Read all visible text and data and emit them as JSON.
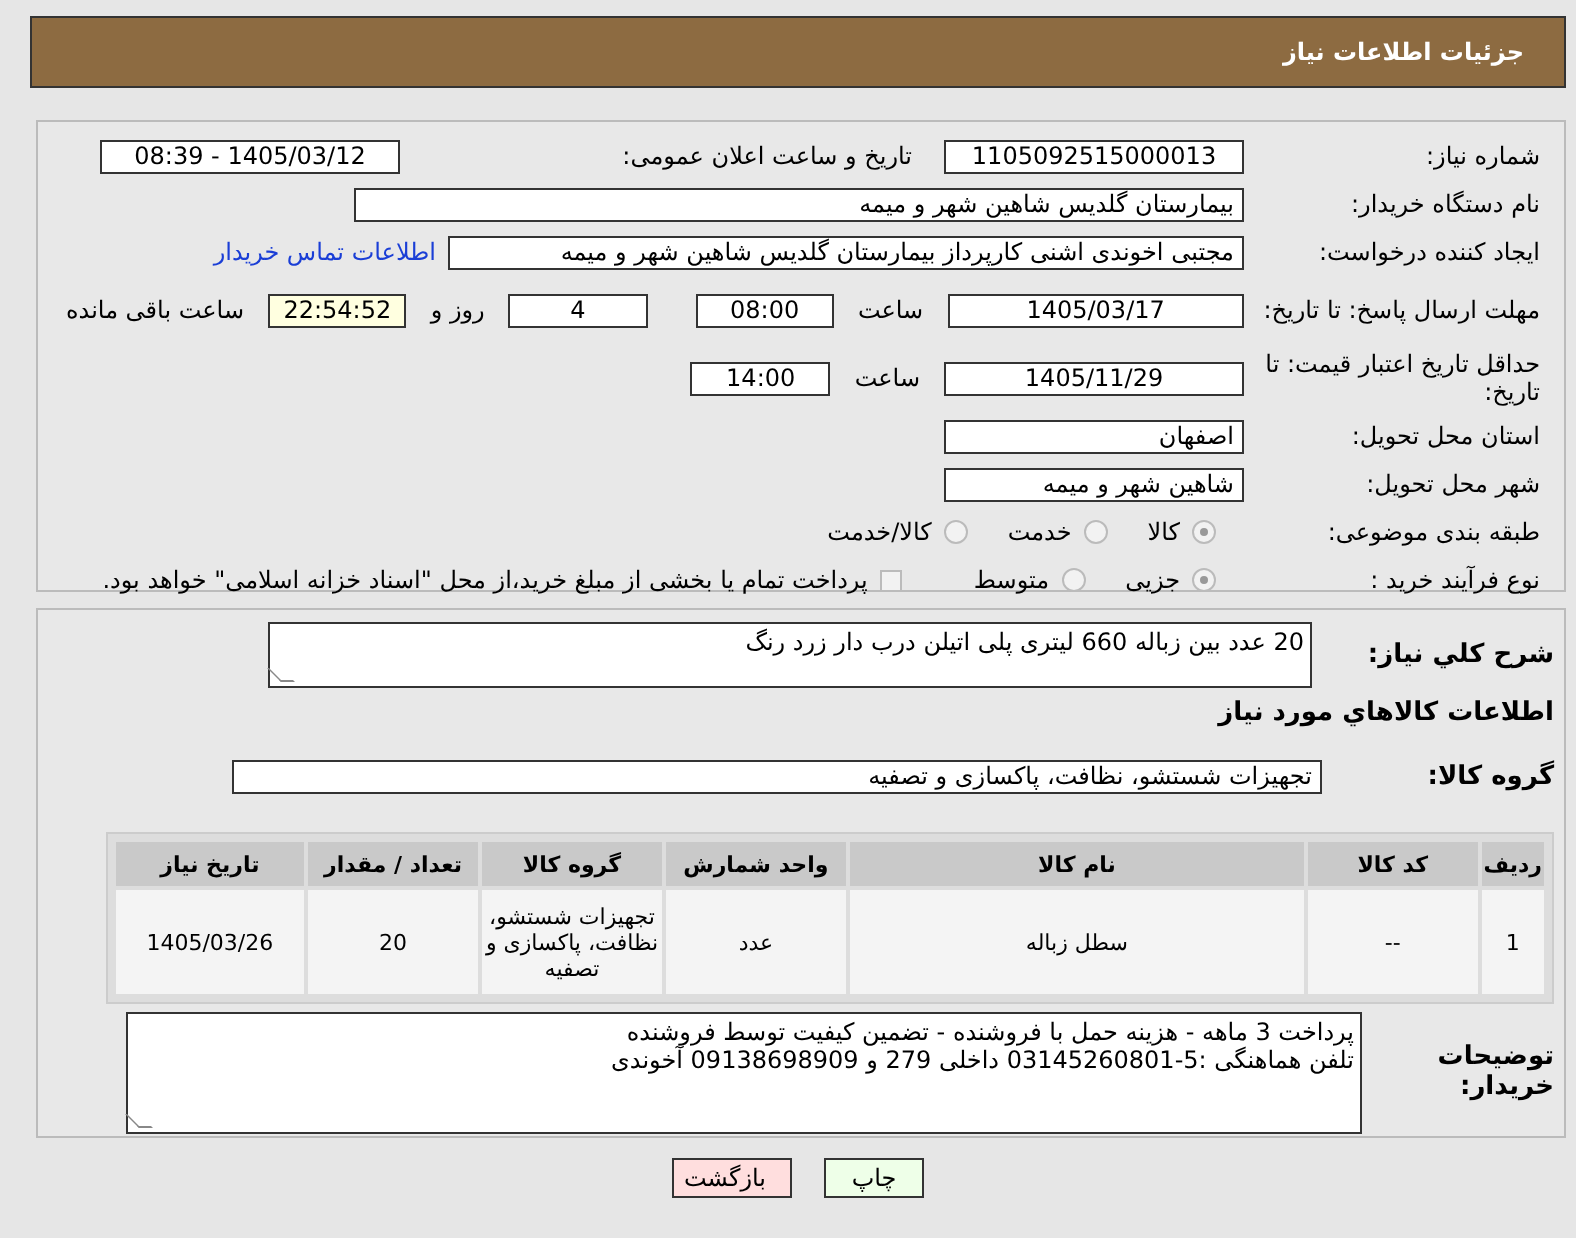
{
  "header": {
    "title": "جزئیات اطلاعات نیاز"
  },
  "need_number": {
    "label": "شماره نیاز:",
    "value": "1105092515000013"
  },
  "announce": {
    "label": "تاریخ و ساعت اعلان عمومی:",
    "value": "1405/03/12 - 08:39"
  },
  "buyer": {
    "label": "نام دستگاه خریدار:",
    "value": "بیمارستان گلدیس  شاهین شهر و میمه"
  },
  "creator": {
    "label": "ایجاد کننده درخواست:",
    "value": "مجتبی اخوندی اشنی کارپرداز بیمارستان گلدیس  شاهین شهر و میمه",
    "link": "اطلاعات تماس خریدار"
  },
  "reply_deadline": {
    "label": "مهلت ارسال پاسخ: تا تاریخ:",
    "date": "1405/03/17",
    "time_label": "ساعت",
    "time": "08:00",
    "days": "4",
    "days_label": "روز و",
    "remaining": "22:54:52",
    "remaining_label": "ساعت باقی مانده"
  },
  "price_validity": {
    "label": "حداقل تاریخ اعتبار قیمت: تا تاریخ:",
    "date": "1405/11/29",
    "time_label": "ساعت",
    "time": "14:00"
  },
  "province": {
    "label": "استان محل تحویل:",
    "value": "اصفهان"
  },
  "city": {
    "label": "شهر محل تحویل:",
    "value": "شاهین شهر و میمه"
  },
  "category": {
    "label": "طبقه بندی موضوعی:",
    "options": [
      {
        "label": "کالا",
        "selected": true
      },
      {
        "label": "خدمت",
        "selected": false
      },
      {
        "label": "کالا/خدمت",
        "selected": false
      }
    ]
  },
  "purchase_type": {
    "label": "نوع فرآیند خرید :",
    "options": [
      {
        "label": "جزیی",
        "selected": true
      },
      {
        "label": "متوسط",
        "selected": false
      }
    ],
    "treasury": {
      "label": "پرداخت تمام یا بخشی از مبلغ خرید،از محل \"اسناد خزانه اسلامی\" خواهد بود.",
      "checked": false
    }
  },
  "description": {
    "label": "شرح کلي نياز:",
    "value": "20 عدد بین زباله 660 لیتری پلی اتیلن درب دار زرد رنگ"
  },
  "goods_heading": "اطلاعات كالاهاي مورد نياز",
  "goods_group": {
    "label": "گروه کالا:",
    "value": "تجهیزات شستشو، نظافت، پاکسازی و تصفیه"
  },
  "table": {
    "columns": [
      "ردیف",
      "کد کالا",
      "نام کالا",
      "واحد شمارش",
      "گروه کالا",
      "تعداد / مقدار",
      "تاریخ نیاز"
    ],
    "rows": [
      [
        "1",
        "--",
        "سطل زباله",
        "عدد",
        "تجهیزات شستشو، نظافت، پاکسازی و تصفیه",
        "20",
        "1405/03/26"
      ]
    ]
  },
  "buyer_notes": {
    "label": "توضیحات خریدار:",
    "lines": [
      "پرداخت 3 ماهه - هزینه حمل با فروشنده - تضمین کیفیت توسط فروشنده",
      "تلفن هماهنگی :5-03145260801 داخلی 279 و 09138698909 آخوندی"
    ]
  },
  "buttons": [
    {
      "label": "چاپ",
      "kind": "print"
    },
    {
      "label": "بازگشت",
      "kind": "back"
    }
  ]
}
